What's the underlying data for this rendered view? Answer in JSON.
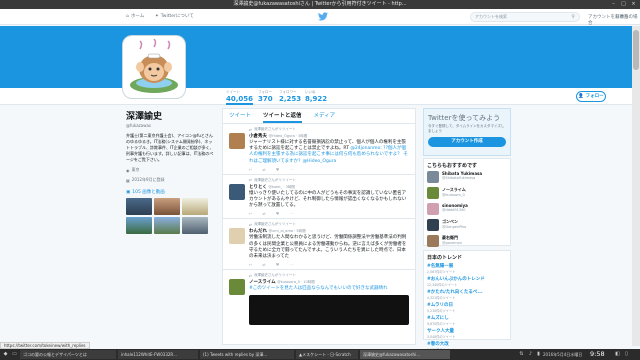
{
  "window": {
    "title": "深澤諭史@fukazawasatoshiさん | Twitterから引用符付きツイート - http...",
    "min": "–",
    "max": "□",
    "close": "×"
  },
  "topnav": {
    "home": "ホーム",
    "about": "Twitterについて",
    "search_placeholder": "アカウントを検索",
    "signin": "アカウントをお持ちの場合",
    "language": "日本語"
  },
  "profile": {
    "name": "深澤諭史",
    "handle": "@fukazawas",
    "bio": "弁護士(第二東京弁護士会)、アイコン@fuとさんのゆるゆるき。IT法務(システム開発紛争)、ネットトラブル、詐欺事件、IT企業のご相談が多く、刑事弁護も行います。詳しい記事は、IT法務のページをご覧下さい。",
    "location": "東京",
    "joined": "2012年9月に登録",
    "photos_label": "105 画像と動画"
  },
  "stats": [
    {
      "label": "ツイート",
      "value": "40,056"
    },
    {
      "label": "フォロー",
      "value": "370"
    },
    {
      "label": "フォロワー",
      "value": "2,253"
    },
    {
      "label": "いいね",
      "value": "8,922"
    }
  ],
  "follow_button": "フォロー",
  "tabs": [
    "ツイート",
    "ツイートと返信",
    "メディア"
  ],
  "tweets": [
    {
      "rt": "深澤諭史さんがリツイート",
      "name": "小倉秀夫",
      "handle": "@Hideo_Ogura · 3時間",
      "text": "ジャーナリスト様に対する名誉毀損訴訟の禁止って、個人が個人の権利を主張するために訴訟を起こすことは禁止ですよね。RT",
      "highlight": "@24jonanmo: ??個人が個人の権利を主張する為に訴訟を起こす事には何ら何も咎められないですよ？ それはご理解頂いてますか？@Hideo_Ogura",
      "reply": "↩",
      "retweet": "⇄",
      "like": "♥",
      "more": "⋯"
    },
    {
      "rt": "深澤諭史さんがリツイート",
      "name": "とりとく",
      "handle": "@tokei_ · 3時間",
      "text": "憶いっきり使いたしてるのに中の人がどうもその事実を認識していない匿名アカウントがあるんやけど、それ制御したら情報が認出くなくなるかもしれないから黙って放置してる。",
      "highlight": "",
      "reply": "↩",
      "retweet": "⇄",
      "like": "♥",
      "more": "⋯"
    },
    {
      "rt": "深澤諭史さんがリツイート",
      "name": "わんだれ",
      "handle": "@umi_ai_ama · 5時間",
      "text": "労働法制流した人間なわかると思うけど、労働関係調整法や労働基準法の判例の多くは民間企業と公務員による労働運動からね。逆に言えば多くが労働者を守るために全力で闘ってたんですよ。こういう人たちを異にした時点で、日本の未来は決まってた",
      "highlight": "",
      "reply": "↩",
      "retweet": "⇄",
      "like": "♥",
      "more": "⋯"
    },
    {
      "rt": "深澤諭史さんがリツイート",
      "name": "ノースライム",
      "handle": "@kurosora_0 · 10時間",
      "text": "",
      "highlight": "#このツイートを見た人は匹品ならなんでもいいので好きな武器晴れ",
      "reply": "↩",
      "retweet": "⇄",
      "like": "♥",
      "more": "⋯"
    }
  ],
  "signup": {
    "title": "Twitterを使ってみよう",
    "subtitle": "今すぐ登録して、タイムラインをカスタマイズしましょう",
    "button": "アカウント作成"
  },
  "wtf": {
    "title": "こちらもおすすめです",
    "items": [
      {
        "name": "Shibata Yukimasa",
        "handle": "@ShibataYukimasa"
      },
      {
        "name": "ノースライム",
        "handle": "@kurosora_0"
      },
      {
        "name": "sinonomiya",
        "handle": "@dddd91300"
      },
      {
        "name": "ゴンペン",
        "handle": "@GonpenPiko"
      },
      {
        "name": "豪右衛門",
        "handle": "@gouemon"
      }
    ]
  },
  "trends": {
    "title": "日本のトレンド",
    "items": [
      {
        "t": "#名無陽一展",
        "d": "2,567件のツイート"
      },
      {
        "t": "#おんいんぶかんのトレンド",
        "d": "12,340件のツイート"
      },
      {
        "t": "#かたれ/たれ向くたるべ...",
        "d": "4,321件のツイート"
      },
      {
        "t": "#ムラリの日",
        "d": "5,210件のツイート"
      },
      {
        "t": "#ムズにし",
        "d": "9,870件のツイート"
      },
      {
        "t": "サーク人大量",
        "d": "3,040件のツイート"
      },
      {
        "t": "#春の大改",
        "d": "1,990件のツイート"
      }
    ]
  },
  "statusbar": {
    "url": "https://twitter.com/tokeinew/with_replies"
  },
  "taskbar": {
    "tasks": [
      "ゴコの要の公報とデザイパーツとは",
      "inhale112WhitE-FW0332R...",
      "(1) Tweets with replies by 深澤...",
      "▲メスケシート - 日-Scratch",
      "深澤諭史@fukazawasatoshi..."
    ],
    "date": "2016年5月4日水曜日",
    "time": "9:58"
  },
  "colors": {
    "brand": "#1b95e0",
    "banner": "#1b95e0"
  }
}
